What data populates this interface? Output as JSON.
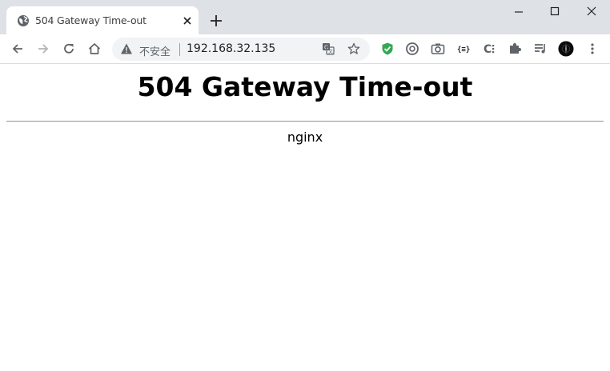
{
  "browser": {
    "tab": {
      "title": "504 Gateway Time-out",
      "favicon": "globe-icon",
      "close_icon": "close-icon"
    },
    "new_tab_icon": "plus-icon",
    "window_controls": [
      "minimize-icon",
      "maximize-icon",
      "close-window-icon"
    ],
    "toolbar": {
      "back_icon": "arrow-left-icon",
      "forward_icon": "arrow-right-icon",
      "reload_icon": "reload-icon",
      "home_icon": "home-icon",
      "address_bar": {
        "security_icon": "warning-icon",
        "security_label": "不安全",
        "url": "192.168.32.135",
        "translate_icon": "translate-icon",
        "bookmark_icon": "star-icon"
      },
      "extensions": [
        "shield-check-icon",
        "circle-c-icon",
        "camera-icon",
        "json-icon",
        "c-extension-icon",
        "puzzle-icon",
        "playlist-icon",
        "profile-avatar"
      ],
      "menu_icon": "kebab-menu-icon"
    },
    "colors": {
      "tabstrip_bg": "#dee1e6",
      "omnibox_bg": "#f1f3f4",
      "shield_green": "#34a853"
    }
  },
  "page": {
    "heading": "504 Gateway Time-out",
    "server": "nginx"
  }
}
